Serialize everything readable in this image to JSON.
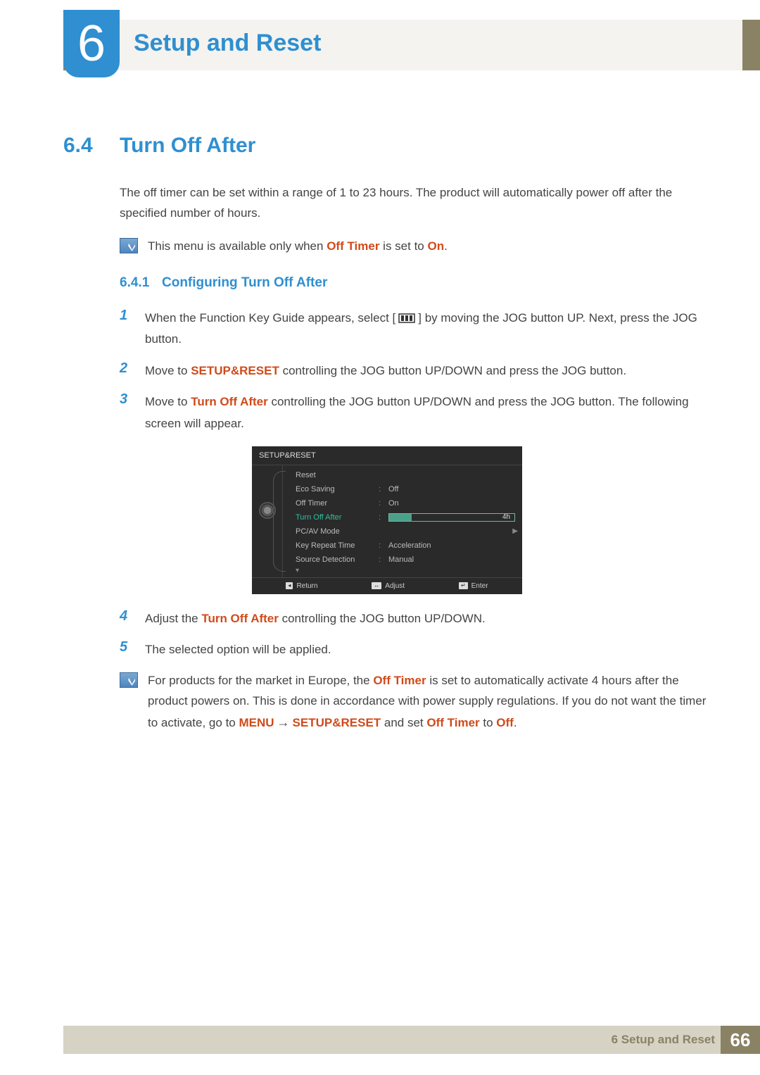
{
  "chapter": {
    "number": "6",
    "title": "Setup and Reset"
  },
  "section": {
    "number": "6.4",
    "title": "Turn Off After"
  },
  "intro": "The off timer can be set within a range of 1 to 23 hours. The product will automatically power off after the specified number of hours.",
  "note1": {
    "pre": "This menu is available only when ",
    "bold1": "Off Timer",
    "mid": " is set to ",
    "bold2": "On",
    "post": "."
  },
  "subsection": {
    "number": "6.4.1",
    "title": "Configuring Turn Off After"
  },
  "steps": {
    "s1a": "When the Function Key Guide appears, select ",
    "s1b": " by moving the JOG button UP. Next, press the JOG button.",
    "s2a": "Move to ",
    "s2bold": "SETUP&RESET",
    "s2b": " controlling the JOG button UP/DOWN and press the JOG button.",
    "s3a": "Move to ",
    "s3bold": "Turn Off After",
    "s3b": " controlling the JOG button UP/DOWN and press the JOG button. The following screen will appear.",
    "s4a": "Adjust the ",
    "s4bold": "Turn Off After",
    "s4b": " controlling the JOG button UP/DOWN.",
    "s5": "The selected option will be applied."
  },
  "osd": {
    "title": "SETUP&RESET",
    "items": [
      {
        "label": "Reset",
        "value": ""
      },
      {
        "label": "Eco Saving",
        "value": "Off"
      },
      {
        "label": "Off Timer",
        "value": "On"
      },
      {
        "label": "Turn Off After",
        "value": "4h",
        "active": true,
        "slider": true
      },
      {
        "label": "PC/AV Mode",
        "value": "",
        "caret": true
      },
      {
        "label": "Key Repeat Time",
        "value": "Acceleration"
      },
      {
        "label": "Source Detection",
        "value": "Manual"
      }
    ],
    "footer": {
      "return": "Return",
      "adjust": "Adjust",
      "enter": "Enter"
    }
  },
  "note2": {
    "t1": "For products for the market in Europe, the ",
    "b1": "Off Timer",
    "t2": " is set to automatically activate 4 hours after the product powers on. This is done in accordance with power supply regulations. If you do not want the timer to activate, go to ",
    "b2": "MENU",
    "t3": "SETUP&RESET",
    "t4": " and set ",
    "b3": "Off Timer",
    "t5": " to ",
    "b4": "Off",
    "t6": "."
  },
  "footer": {
    "text": "6 Setup and Reset",
    "page": "66"
  }
}
